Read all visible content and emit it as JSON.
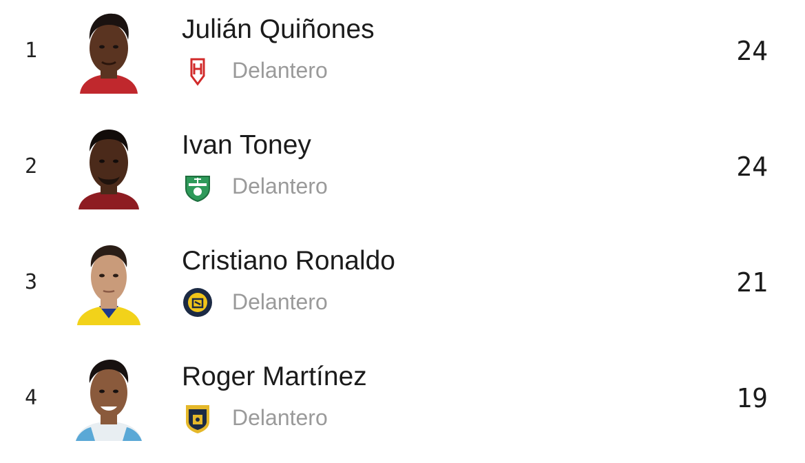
{
  "players": [
    {
      "rank": "1",
      "name": "Julián Quiñones",
      "position": "Delantero",
      "goals": "24",
      "avatar_icon": "player-photo",
      "crest_icon": "club-crest-red",
      "colors": {
        "skin": "#5a3421",
        "hair": "#1a1210",
        "shirt": "#c0282d"
      }
    },
    {
      "rank": "2",
      "name": "Ivan Toney",
      "position": "Delantero",
      "goals": "24",
      "avatar_icon": "player-photo",
      "crest_icon": "club-crest-green",
      "colors": {
        "skin": "#4b2a1a",
        "hair": "#120c0a",
        "shirt": "#8e1c22"
      }
    },
    {
      "rank": "3",
      "name": "Cristiano Ronaldo",
      "position": "Delantero",
      "goals": "21",
      "avatar_icon": "player-photo",
      "crest_icon": "club-crest-navy-gold",
      "colors": {
        "skin": "#c99b7a",
        "hair": "#2a1d16",
        "shirt": "#f2d21a"
      }
    },
    {
      "rank": "4",
      "name": "Roger Martínez",
      "position": "Delantero",
      "goals": "19",
      "avatar_icon": "player-photo",
      "crest_icon": "club-crest-gold-navy",
      "colors": {
        "skin": "#8a5a3c",
        "hair": "#171110",
        "shirt": "#e8eef2"
      }
    }
  ]
}
